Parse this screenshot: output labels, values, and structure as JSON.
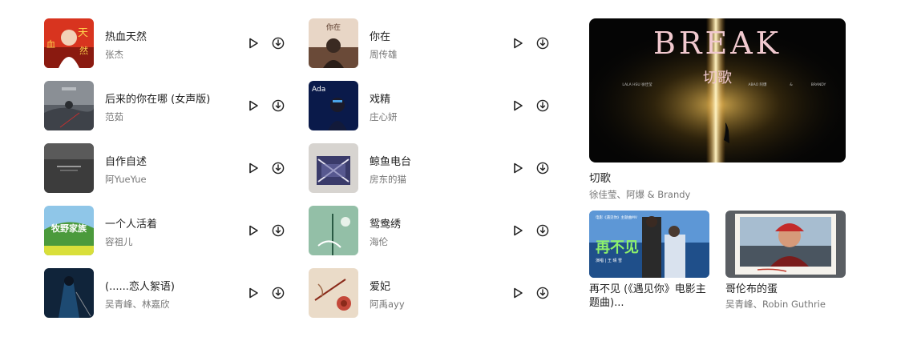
{
  "songs_left": [
    {
      "title": "热血天然",
      "artist": "张杰",
      "cover": "cover-rexue"
    },
    {
      "title": "后来的你在哪 (女声版)",
      "artist": "范茹",
      "cover": "cover-houlai"
    },
    {
      "title": "自作自述",
      "artist": "阿YueYue",
      "cover": "cover-zizuo"
    },
    {
      "title": "一个人活着",
      "artist": "容祖儿",
      "cover": "cover-yigeren",
      "cover_text": "牧野家族"
    },
    {
      "title": "(......恋人絮语)",
      "artist": "吴青峰、林嘉欣",
      "cover": "cover-lianren"
    }
  ],
  "songs_right": [
    {
      "title": "你在",
      "artist": "周传雄",
      "cover": "cover-nizai",
      "cover_text": "你在"
    },
    {
      "title": "戏精",
      "artist": "庄心妍",
      "cover": "cover-xijing",
      "cover_text": "Ada"
    },
    {
      "title": "鲸鱼电台",
      "artist": "房东的猫",
      "cover": "cover-jingyu"
    },
    {
      "title": "鸳鸯绣",
      "artist": "海伦",
      "cover": "cover-yuanyang"
    },
    {
      "title": "爱妃",
      "artist": "阿禹ayy",
      "cover": "cover-aifei"
    }
  ],
  "feature": {
    "title": "切歌",
    "artist": "徐佳莹、阿爆 & Brandy",
    "cover_text": "BREAK",
    "cover_subtext": "切歌",
    "cover_credits": [
      "LALA HSU 徐佳莹",
      "ABAO 阿爆",
      "&",
      "BRANDY"
    ]
  },
  "mvs": [
    {
      "title": "再不见 (《遇见你》电影主题曲)...",
      "artist": "",
      "cover_text": "再不见",
      "cover_tag": "电影《遇见你》主题曲MV",
      "cover_credit": "演唱 | 王 晴 雪"
    },
    {
      "title": "哥伦布的蛋",
      "artist": "吴青峰、Robin Guthrie"
    }
  ],
  "icons": {
    "play": "play-icon",
    "download": "download-icon"
  },
  "colors": {
    "title_text": "#222222",
    "artist_text": "#777777"
  }
}
